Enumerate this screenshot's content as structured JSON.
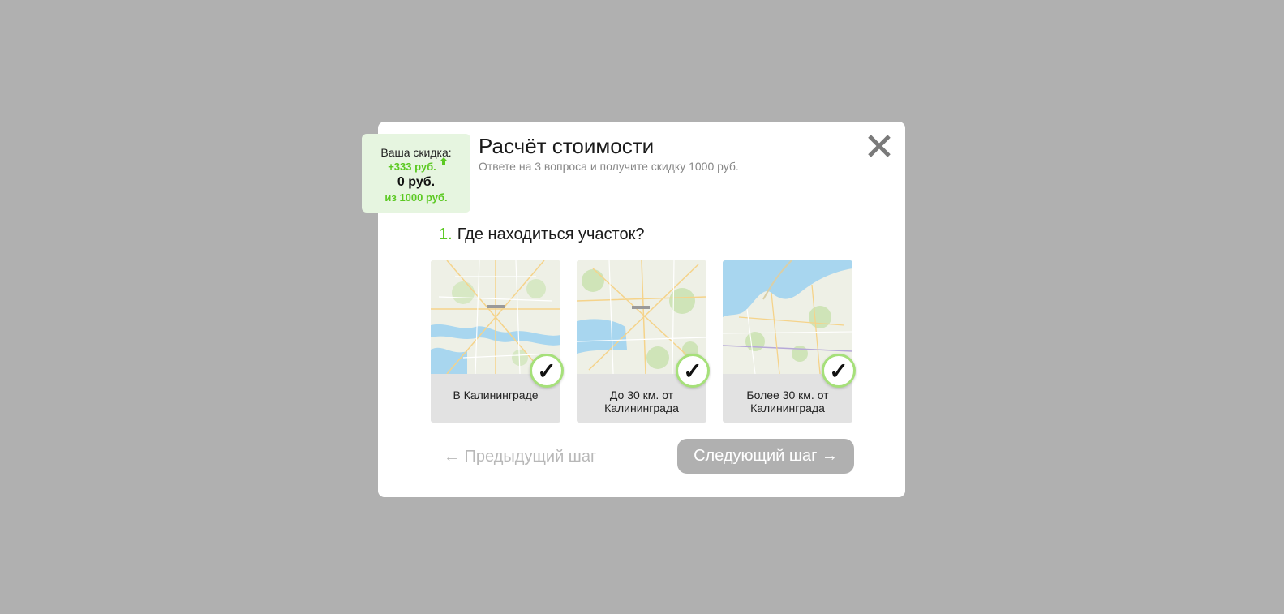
{
  "modal": {
    "title": "Расчёт стоимости",
    "subtitle": "Ответе на 3 вопроса и получите скидку 1000 руб."
  },
  "discount": {
    "label": "Ваша скидка:",
    "added": "+333 руб.",
    "current": "0 руб.",
    "total": "из 1000 руб."
  },
  "question": {
    "number": "1.",
    "text": "Где находиться участок?"
  },
  "options": [
    {
      "label": "В Калининграде",
      "selected": true
    },
    {
      "label": "До 30 км. от Калининграда",
      "selected": true
    },
    {
      "label": "Более 30 км. от Калининграда",
      "selected": true
    }
  ],
  "navigation": {
    "prev_label": "← Предыдущий шаг",
    "next_label": "Следующий шаг →"
  },
  "icons": {
    "check": "✓",
    "close": "close-icon",
    "arrow_up": "arrow-up-icon"
  },
  "colors": {
    "accent": "#5bc922",
    "check_border": "#a6e07a",
    "discount_bg": "#e6f5e0",
    "overlay": "#b0b0b0",
    "next_button": "#b0b0b0"
  }
}
